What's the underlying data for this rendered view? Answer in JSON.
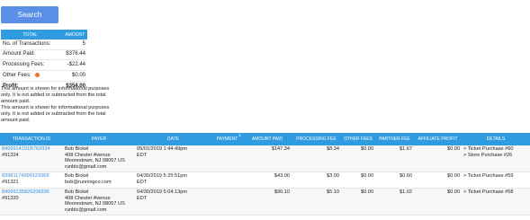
{
  "search": {
    "label": "Search"
  },
  "summary": {
    "headers": {
      "total": "TOTAL",
      "amount": "AMOUNT"
    },
    "rows": [
      {
        "label": "No. of Transactions:",
        "value": "5"
      },
      {
        "label": "Amount Paid:",
        "value": "$376.44"
      },
      {
        "label": "Processing Fees:",
        "value": "-$22.44"
      },
      {
        "label": "Other Fees:",
        "value": "$0.00"
      },
      {
        "label": "Profit:",
        "value": "$354.00"
      }
    ],
    "notes": [
      "This amount is shown for informational purposes only. It is not added or subtracted from the total amount paid.",
      "This amount is shown for informational purposes only. It is not added or subtracted from the total amount paid."
    ],
    "other_fees_icon_color": "#e8742c"
  },
  "table": {
    "headers": {
      "transaction_id": "TRANSACTION ID",
      "payer": "PAYER",
      "date": "DATE",
      "payment": "PAYMENT",
      "payment_mark": "1",
      "amount_paid": "AMOUNT PAID",
      "processing_fee": "PROCESSING FEE",
      "other_fees": "OTHER FEES",
      "partner_fee": "PARTNER FEE",
      "affiliate_profit": "AFFILIATE PROFIT",
      "details": "DETAILS"
    },
    "rows": [
      {
        "tx_id": "8406914191B762034",
        "order": "#91324",
        "payer_name": "Bob Bickel",
        "payer_addr1": "408 Chester Avenue",
        "payer_addr2": "Moorestown, NJ 08057 US",
        "payer_email": "runbic@gmail.com",
        "date": "05/01/2019 1:44:49pm",
        "tz": "EDT",
        "payment": "",
        "amount_paid": "$147.34",
        "processing_fee": "$8.34",
        "other_fees": "$0.00",
        "partner_fee": "$1.67",
        "affiliate_profit": "$0.00",
        "details_1": "> Ticket Purchase #60",
        "details_2": "> Store Purchase #26"
      },
      {
        "tx_id": "83981174999123369",
        "order": "#91321",
        "payer_name": "Bob Bickel",
        "payer_addr1": "bob@runningco.com",
        "payer_addr2": "",
        "payer_email": "",
        "date": "04/30/2019 5:25:51pm",
        "tz": "EDT",
        "payment": "",
        "amount_paid": "$43.00",
        "processing_fee": "$3.00",
        "other_fees": "$0.00",
        "partner_fee": "$0.60",
        "affiliate_profit": "$0.00",
        "details_1": "> Ticket Purchase #59",
        "details_2": ""
      },
      {
        "tx_id": "84069135826206936",
        "order": "#91320",
        "payer_name": "Bob Bickel",
        "payer_addr1": "408 Chester Avenue",
        "payer_addr2": "Moorestown, NJ 08057 US",
        "payer_email": "runbic@gmail.com",
        "date": "04/30/2019 5:04:13pm",
        "tz": "EDT",
        "payment": "",
        "amount_paid": "$90.10",
        "processing_fee": "$5.10",
        "other_fees": "$0.00",
        "partner_fee": "$1.02",
        "affiliate_profit": "$0.00",
        "details_1": "> Ticket Purchase #58",
        "details_2": ""
      }
    ]
  },
  "colors": {
    "accent": "#2f9ce2",
    "button": "#5b8fe6",
    "link": "#2f8fe0"
  }
}
